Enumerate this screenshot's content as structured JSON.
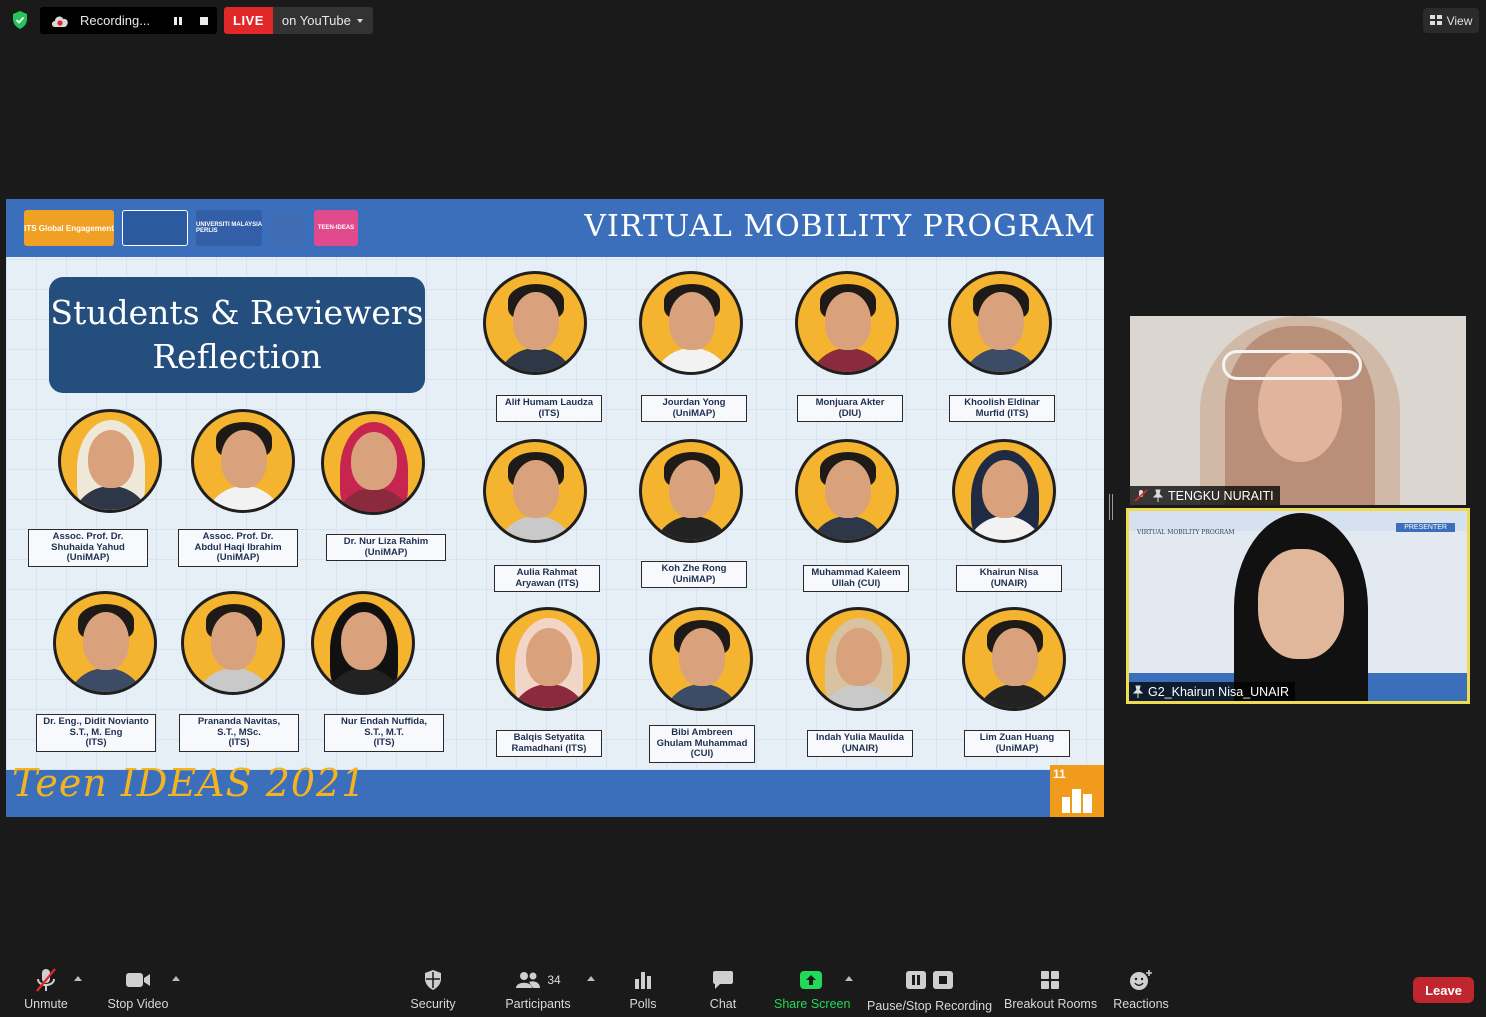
{
  "topbar": {
    "recording_label": "Recording...",
    "live_label": "LIVE",
    "stream_target": "on YouTube",
    "view_label": "View"
  },
  "slide": {
    "header_title": "VIRTUAL MOBILITY PROGRAM",
    "logo_texts": [
      "ITS Global Engagement",
      "UNIVERSITI MALAYSIA PERLIS",
      "TEEN-IDEAS"
    ],
    "title_line1": "Students & Reviewers",
    "title_line2": "Reflection",
    "footer_title": "Teen IDEAS 2021",
    "sdg_number": "11",
    "reviewers": [
      {
        "line1": "Assoc. Prof. Dr.",
        "line2": "Shuhaida Yahud",
        "line3": "(UniMAP)"
      },
      {
        "line1": "Assoc. Prof. Dr.",
        "line2": "Abdul Haqi Ibrahim",
        "line3": "(UniMAP)"
      },
      {
        "line1": "Dr. Nur Liza Rahim",
        "line2": "(UniMAP)",
        "line3": ""
      },
      {
        "line1": "Dr. Eng., Didit Novianto",
        "line2": "S.T., M. Eng",
        "line3": "(ITS)"
      },
      {
        "line1": "Prananda Navitas,",
        "line2": "S.T., MSc.",
        "line3": "(ITS)"
      },
      {
        "line1": "Nur Endah Nuffida,",
        "line2": "S.T., M.T.",
        "line3": "(ITS)"
      }
    ],
    "students": [
      {
        "line1": "Alif Humam Laudza",
        "line2": "(ITS)",
        "line3": ""
      },
      {
        "line1": "Jourdan Yong",
        "line2": "(UniMAP)",
        "line3": ""
      },
      {
        "line1": "Monjuara Akter",
        "line2": "(DIU)",
        "line3": ""
      },
      {
        "line1": "Khoolish Eldinar",
        "line2": "Murfid (ITS)",
        "line3": ""
      },
      {
        "line1": "Aulia Rahmat",
        "line2": "Aryawan (ITS)",
        "line3": ""
      },
      {
        "line1": "Koh Zhe Rong",
        "line2": "(UniMAP)",
        "line3": ""
      },
      {
        "line1": "Muhammad Kaleem",
        "line2": "Ullah (CUI)",
        "line3": ""
      },
      {
        "line1": "Khairun Nisa",
        "line2": "(UNAIR)",
        "line3": ""
      },
      {
        "line1": "Balqis Setyatita",
        "line2": "Ramadhani (ITS)",
        "line3": ""
      },
      {
        "line1": "Bibi Ambreen",
        "line2": "Ghulam Muhammad",
        "line3": "(CUI)"
      },
      {
        "line1": "Indah Yulia Maulida",
        "line2": "(UNAIR)",
        "line3": ""
      },
      {
        "line1": "Lim Zuan Huang",
        "line2": "(UniMAP)",
        "line3": ""
      }
    ]
  },
  "participants": [
    {
      "name": "TENGKU NURAITI"
    },
    {
      "name": "G2_Khairun Nisa_UNAIR",
      "background_title": "VIRTUAL MOBILITY PROGRAM",
      "background_badge": "PRESENTER"
    }
  ],
  "toolbar": {
    "unmute": "Unmute",
    "stop_video": "Stop Video",
    "security": "Security",
    "participants": "Participants",
    "participant_count": "34",
    "polls": "Polls",
    "chat": "Chat",
    "share_screen": "Share Screen",
    "pause_stop_recording": "Pause/Stop Recording",
    "breakout_rooms": "Breakout Rooms",
    "reactions": "Reactions",
    "leave": "Leave"
  },
  "colors": {
    "background": "#1a1a1a",
    "live_red": "#e02828",
    "share_green": "#23d959",
    "leave_red": "#c0262d",
    "active_speaker": "#eedb52",
    "slide_blue": "#3b6fbb",
    "slide_orange": "#f4b42f"
  }
}
